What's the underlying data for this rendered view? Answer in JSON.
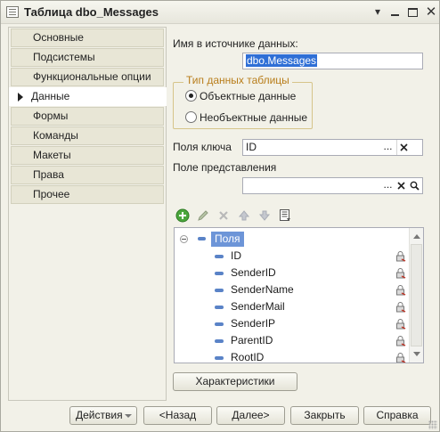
{
  "window": {
    "title": "Таблица dbo_Messages",
    "controls": {
      "menu": "▾",
      "minimize": "",
      "maximize": "",
      "close": "✕"
    }
  },
  "nav": {
    "items": [
      {
        "label": "Основные",
        "active": false
      },
      {
        "label": "Подсистемы",
        "active": false
      },
      {
        "label": "Функциональные опции",
        "active": false
      },
      {
        "label": "Данные",
        "active": true
      },
      {
        "label": "Формы",
        "active": false
      },
      {
        "label": "Команды",
        "active": false
      },
      {
        "label": "Макеты",
        "active": false
      },
      {
        "label": "Права",
        "active": false
      },
      {
        "label": "Прочее",
        "active": false
      }
    ]
  },
  "data_panel": {
    "source_name_label": "Имя в источнике данных:",
    "source_name_value": "dbo.Messages",
    "table_type": {
      "label": "Тип данных таблицы",
      "options": [
        {
          "label": "Объектные данные",
          "selected": true
        },
        {
          "label": "Необъектные данные",
          "selected": false
        }
      ]
    },
    "key_fields_label": "Поля ключа",
    "key_fields_value": "ID",
    "presentation_field_label": "Поле представления",
    "presentation_field_value": "",
    "field_buttons": {
      "choose": "...",
      "clear": "✕"
    },
    "toolbar_icons": [
      "add-icon",
      "edit-icon",
      "delete-icon",
      "move-up-icon",
      "move-down-icon",
      "list-icon"
    ],
    "tree": {
      "root_label": "Поля",
      "fields": [
        "ID",
        "SenderID",
        "SenderName",
        "SenderMail",
        "SenderIP",
        "ParentID",
        "RootID"
      ]
    },
    "characteristics_button": "Характеристики"
  },
  "footer": {
    "actions": "Действия",
    "back": "<Назад",
    "next": "Далее>",
    "close": "Закрыть",
    "help": "Справка"
  },
  "colors": {
    "window_bg": "#f2f1e8",
    "nav_item_bg": "#e8e6d6",
    "selection": "#2f6fd6",
    "group_title": "#b87d1a",
    "tree_root_highlight": "#6d95d8"
  }
}
